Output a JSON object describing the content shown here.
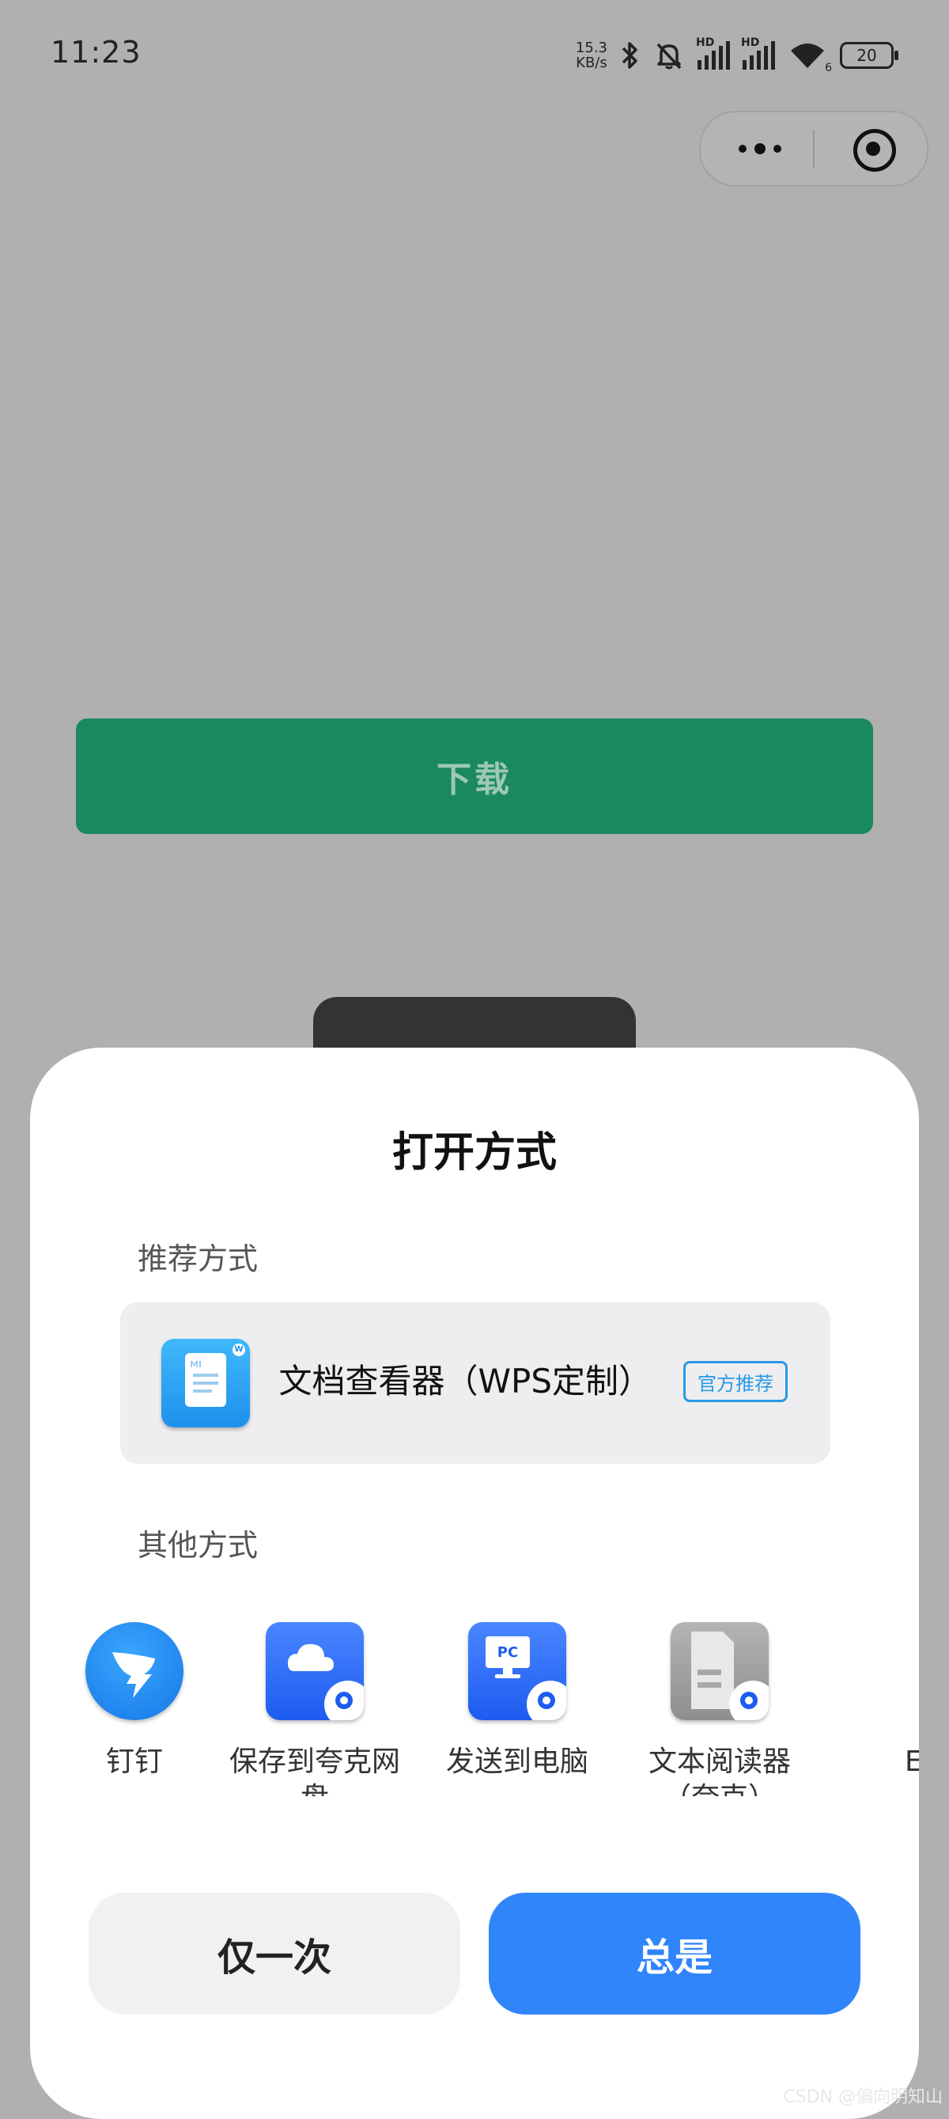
{
  "status_bar": {
    "time": "11:23",
    "net_speed_value": "15.3",
    "net_speed_unit": "KB/s",
    "signal_1_label": "HD",
    "signal_2_label": "HD",
    "wifi_badge": "6",
    "battery": "20"
  },
  "page": {
    "download_label": "下载"
  },
  "sheet": {
    "title": "打开方式",
    "recommended_label": "推荐方式",
    "recommended_app": {
      "name": "文档查看器（WPS定制）",
      "badge": "官方推荐",
      "icon": "document-viewer-icon"
    },
    "other_label": "其他方式",
    "other_apps": [
      {
        "label": "钉钉",
        "icon": "dingtalk-icon"
      },
      {
        "label": "保存到夸克网盘",
        "icon": "quark-cloud-icon"
      },
      {
        "label": "发送到电脑",
        "icon": "send-to-pc-icon"
      },
      {
        "label": "文本阅读器（夸克）",
        "icon": "text-reader-icon"
      },
      {
        "label": "E"
      }
    ],
    "once_button": "仅一次",
    "always_button": "总是"
  },
  "watermark": "CSDN @偏向明知山",
  "colors": {
    "overlay_background": "#b0b0b0",
    "download_button": "#1a8a5e",
    "primary_button": "#3185fb",
    "badge_blue": "#2a99e6"
  }
}
